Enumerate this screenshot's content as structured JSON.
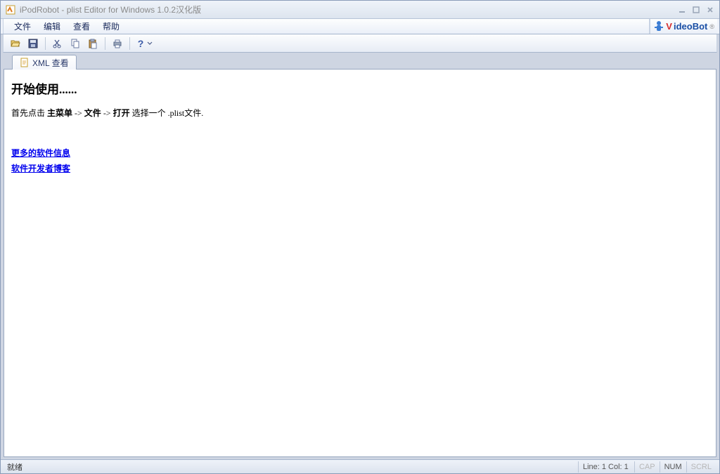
{
  "window": {
    "title": "iPodRobot - plist Editor for Windows 1.0.2汉化版"
  },
  "menus": {
    "file": "文件",
    "edit": "编辑",
    "view": "查看",
    "help": "帮助"
  },
  "branding": {
    "text": "VideoBot"
  },
  "tabs": {
    "xmlview": "XML 查看"
  },
  "content": {
    "heading": "开始使用......",
    "instr_prefix": "首先点击 ",
    "instr_bold1": "主菜单",
    "instr_arrow1": " -> ",
    "instr_bold2": "文件",
    "instr_arrow2": " -> ",
    "instr_bold3": "打开",
    "instr_suffix": " 选择一个 .plist文件.",
    "link1": "更多的软件信息",
    "link2": "软件开发者博客"
  },
  "status": {
    "ready": "就绪",
    "linecol": "Line: 1 Col: 1",
    "cap": "CAP",
    "num": "NUM",
    "scrl": "SCRL"
  }
}
